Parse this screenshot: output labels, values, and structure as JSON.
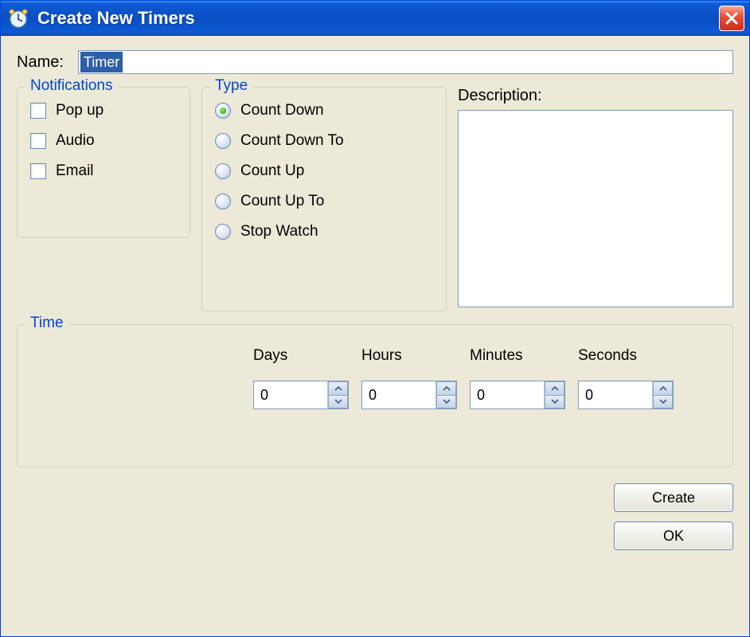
{
  "window": {
    "title": "Create New Timers",
    "icon": "clock-icon"
  },
  "name": {
    "label": "Name:",
    "value": "Timer"
  },
  "notifications": {
    "legend": "Notifications",
    "items": [
      {
        "label": "Pop up",
        "checked": false
      },
      {
        "label": "Audio",
        "checked": false
      },
      {
        "label": "Email",
        "checked": false
      }
    ]
  },
  "type": {
    "legend": "Type",
    "options": [
      {
        "label": "Count Down",
        "selected": true
      },
      {
        "label": "Count Down To",
        "selected": false
      },
      {
        "label": "Count Up",
        "selected": false
      },
      {
        "label": "Count Up To",
        "selected": false
      },
      {
        "label": "Stop Watch",
        "selected": false
      }
    ]
  },
  "description": {
    "label": "Description:",
    "value": ""
  },
  "time": {
    "legend": "Time",
    "fields": [
      {
        "label": "Days",
        "value": "0"
      },
      {
        "label": "Hours",
        "value": "0"
      },
      {
        "label": "Minutes",
        "value": "0"
      },
      {
        "label": "Seconds",
        "value": "0"
      }
    ]
  },
  "buttons": {
    "create": "Create",
    "ok": "OK"
  }
}
